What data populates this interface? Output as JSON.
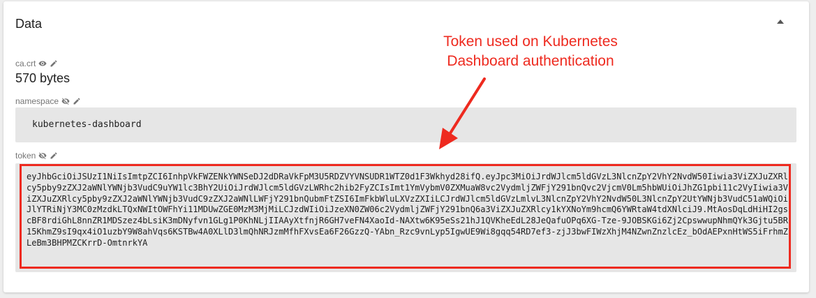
{
  "card": {
    "title": "Data"
  },
  "fields": {
    "ca_crt": {
      "label": "ca.crt",
      "value": "570 bytes"
    },
    "namespace": {
      "label": "namespace",
      "value": "kubernetes-dashboard"
    },
    "token": {
      "label": "token",
      "value": "eyJhbGciOiJSUzI1NiIsImtpZCI6InhpVkFWZENkYWNSeDJ2dDRaVkFpM3U5RDZVYVNSUDR1WTZ0d1F3Wkhyd28ifQ.eyJpc3MiOiJrdWJlcm5ldGVzL3NlcnZpY2VhY2NvdW50Iiwia3ViZXJuZXRlcy5pby9zZXJ2aWNlYWNjb3VudC9uYW1lc3BhY2UiOiJrdWJlcm5ldGVzLWRhc2hib2FyZCIsImt1YmVybmV0ZXMuaW8vc2VydmljZWFjY291bnQvc2VjcmV0Lm5hbWUiOiJhZG1pbi11c2VyIiwia3ViZXJuZXRlcy5pby9zZXJ2aWNlYWNjb3VudC9zZXJ2aWNlLWFjY291bnQubmFtZSI6ImFkbWluLXVzZXIiLCJrdWJlcm5ldGVzLmlvL3NlcnZpY2VhY2NvdW50L3NlcnZpY2UtYWNjb3VudC51aWQiOiJlYTRiNjY3MC0zMzdkLTQxNWItOWFhYi11MDUwZGE0MzM3MjMiLCJzdWIiOiJzeXN0ZW06c2VydmljZWFjY291bnQ6a3ViZXJuZXRlcy1kYXNoYm9hcmQ6YWRtaW4tdXNlciJ9.MtAosDqLdHiHI2gscBF8rdiGhL8nnZR1MDSzez4bLsiK3mDNyfvn1GLg1P0KhNLjIIAAyXtfnjR6GH7veFN4XaoId-NAXtw6K95eSs21hJ1QVKheEdL28JeQafuOPq6XG-Tze-9JOBSKGi6Zj2CpswwupNhmQYk3Gjtu5BR15KhmZ9sI9qx4iO1uzbY9W8ahVqs6KSTBw4A0XLlD3lmQhNRJzmMfhFXvsEa6F26GzzQ-YAbn_Rzc9vnLyp5IgwUE9Wi8gqq54RD7ef3-zjJ3bwFIWzXhjM4NZwnZnzlcEz_bOdAEPxnHtWS5iFrhmZLeBm3BHPMZCKrrD-OmtnrkYA"
    }
  },
  "annotation": {
    "text": "Token used on Kubernetes Dashboard authentication",
    "color": "#ee2a1f"
  },
  "icons": {
    "ca_crt": [
      "eye-icon",
      "pencil-icon"
    ],
    "namespace": [
      "eye-off-icon",
      "pencil-icon"
    ],
    "token": [
      "eye-off-icon",
      "pencil-icon"
    ]
  }
}
